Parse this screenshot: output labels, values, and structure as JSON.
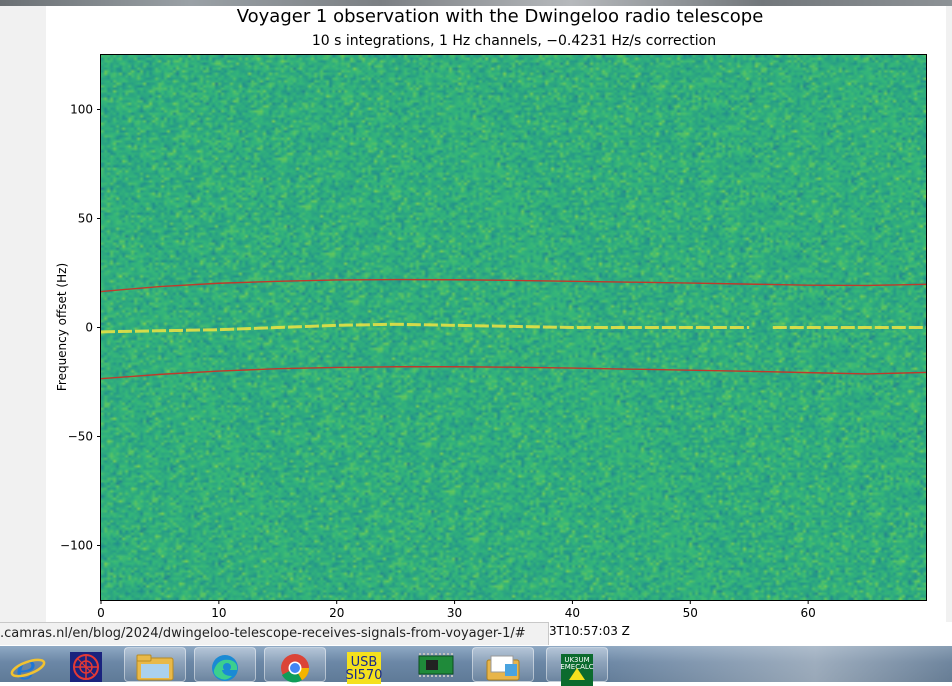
{
  "statusbar": {
    "url": ".camras.nl/en/blog/2024/dwingeloo-telescope-receives-signals-from-voyager-1/#",
    "timestamp_fragment": "3T10:57:03 Z"
  },
  "taskbar": {
    "items": [
      {
        "icon": "internet-explorer-icon",
        "label": ""
      },
      {
        "icon": "radar-app-icon",
        "label": ""
      },
      {
        "icon": "file-explorer-icon",
        "label": ""
      },
      {
        "icon": "edge-browser-icon",
        "label": ""
      },
      {
        "icon": "chrome-browser-icon",
        "label": ""
      },
      {
        "icon": "usb-tool-icon",
        "label": "USB SI570"
      },
      {
        "icon": "circuit-board-icon",
        "label": ""
      },
      {
        "icon": "windows-explorer-icon",
        "label": ""
      },
      {
        "icon": "uk3um-emecalc-icon",
        "label": "UK3UM EMECALC"
      }
    ]
  },
  "chart_data": {
    "type": "heatmap",
    "title": "Voyager 1 observation with the Dwingeloo radio telescope",
    "subtitle": "10 s integrations, 1 Hz channels, −0.4231 Hz/s correction",
    "xlabel": "",
    "ylabel": "Frequency offset (Hz)",
    "xlim": [
      0,
      70
    ],
    "ylim": [
      -125,
      125
    ],
    "x_ticks": [
      0,
      10,
      20,
      30,
      40,
      50,
      60
    ],
    "y_ticks": [
      100,
      50,
      0,
      -50,
      -100
    ],
    "y_tick_labels": [
      "100",
      "50",
      "0",
      "−50",
      "−100"
    ],
    "colormap": "viridis",
    "signal_trace": {
      "name": "",
      "color": "#f0e442",
      "x": [
        0,
        5,
        10,
        15,
        20,
        25,
        30,
        35,
        40,
        45,
        50,
        55,
        56,
        57,
        60,
        65,
        70
      ],
      "y": [
        -2,
        -1.5,
        -1,
        0,
        1,
        1.5,
        1,
        0.5,
        0,
        0,
        0,
        0,
        null,
        0,
        0,
        0,
        0
      ]
    },
    "guide_lines": {
      "color": "#c0392b",
      "upper": {
        "x": [
          0,
          5,
          10,
          15,
          20,
          25,
          30,
          35,
          40,
          45,
          50,
          55,
          60,
          65,
          70
        ],
        "y": [
          16.5,
          18.8,
          20.3,
          21.2,
          21.8,
          22.0,
          21.9,
          21.6,
          21.2,
          20.8,
          20.4,
          19.9,
          19.4,
          19.3,
          19.8
        ]
      },
      "lower": {
        "x": [
          0,
          5,
          10,
          15,
          20,
          25,
          30,
          35,
          40,
          45,
          50,
          55,
          60,
          65,
          70
        ],
        "y": [
          -23.5,
          -21.5,
          -20.0,
          -18.9,
          -18.3,
          -18.0,
          -18.0,
          -18.2,
          -18.6,
          -19.1,
          -19.6,
          -20.1,
          -20.7,
          -21.3,
          -20.6
        ]
      }
    }
  }
}
